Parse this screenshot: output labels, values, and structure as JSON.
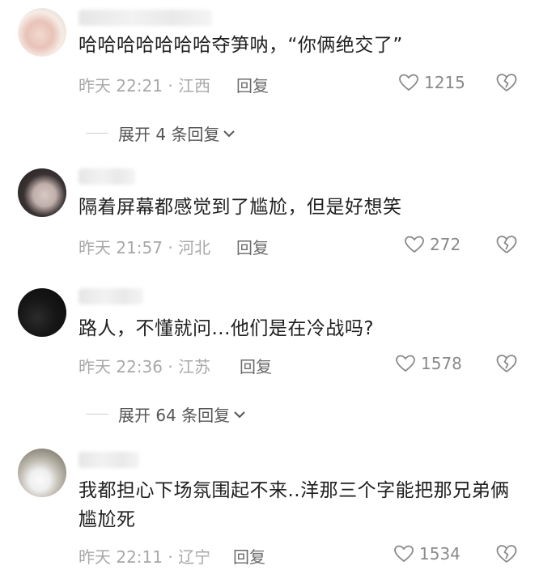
{
  "comments": [
    {
      "text": "哈哈哈哈哈哈哈夺笋呐，“你俩绝交了”",
      "meta": "昨天 22:21 · 江西",
      "reply_label": "回复",
      "likes": "1215",
      "expand_label": "展开 4 条回复"
    },
    {
      "text": "隔着屏幕都感觉到了尴尬，但是好想笑",
      "meta": "昨天 21:57 · 河北",
      "reply_label": "回复",
      "likes": "272"
    },
    {
      "text": "路人，不懂就问...他们是在冷战吗?",
      "meta": "昨天 22:36 · 江苏",
      "reply_label": "回复",
      "likes": "1578",
      "expand_label": "展开 64 条回复"
    },
    {
      "text": "我都担心下场氛围起不来..洋那三个字能把那兄弟俩尴尬死",
      "meta": "昨天 22:11 · 辽宁",
      "reply_label": "回复",
      "likes": "1534"
    }
  ],
  "colors": {
    "text": "#1f1f1f",
    "meta": "#a8a8a8",
    "reply": "#6a6a6a",
    "icon": "#8a8a8a"
  },
  "icons": {
    "like": "heart-outline-icon",
    "dislike": "broken-heart-icon",
    "expand": "chevron-down-icon"
  }
}
